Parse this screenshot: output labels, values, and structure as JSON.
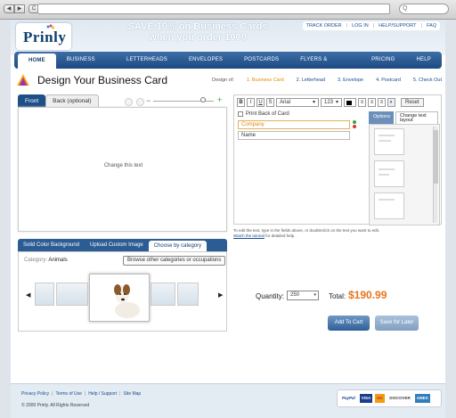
{
  "browser": {
    "back_label": "◀",
    "forward_label": "▶",
    "reload_label": "C",
    "search_label": "Q"
  },
  "header": {
    "logo": "Prinly",
    "promo_line1": "SAVE 10% on Business Cards",
    "promo_line2": "when you order 1000",
    "links": [
      "TRACK ORDER",
      "LOG IN",
      "HELP/SUPPORT",
      "FAQ"
    ]
  },
  "nav": {
    "items": [
      "HOME",
      "BUSINESS CARDS",
      "LETTERHEADS",
      "ENVELOPES",
      "POSTCARDS",
      "FLYERS & BROCHURES",
      "PRICING",
      "HELP"
    ],
    "active_index": 0
  },
  "design": {
    "title": "Design Your Business Card",
    "steps_label": "Design of:",
    "steps": [
      "1. Business Card",
      "2. Letterhead",
      "3. Envelope",
      "4. Postcard",
      "5. Check Out"
    ],
    "current_step": 0
  },
  "preview": {
    "tabs": [
      "Front",
      "Back (optional)"
    ],
    "selected_tab": 0,
    "placeholder": "Change this text"
  },
  "editor": {
    "bold": "B",
    "italic": "I",
    "underline": "U",
    "strike": "S",
    "font": "Arial",
    "size": "123",
    "reset": "Reset",
    "print_back": "Print Back of Card",
    "fields": [
      "Company",
      "Name"
    ],
    "right_tabs": [
      "Options",
      "Change text layout"
    ],
    "hint": "To edit the text, type in the fields above, or doubleclick on the text you want to edit.",
    "hint_link": "Watch the tutorial",
    "hint_tail": "for detailed help."
  },
  "backgrounds": {
    "tabs": [
      "Solid Color Background",
      "Upload Custom Image",
      "Choose by category"
    ],
    "selected_tab": 2,
    "category_label": "Category:",
    "category_value": "Animals",
    "browse_button": "Browse other categories or occupations",
    "prev": "◀",
    "next": "▶"
  },
  "order": {
    "quantity_label": "Quantity:",
    "quantity_value": "250",
    "total_label": "Total:",
    "total_value": "$190.99",
    "add_to_cart": "Add To Cart",
    "save_later": "Save for Later"
  },
  "footer": {
    "links": [
      "Privacy Policy",
      "Terms of Use",
      "Help / Support",
      "Site Map"
    ],
    "copyright": "© 2009 Prinly. All Rights Reserved",
    "payments": [
      "PayPal",
      "VISA",
      "MC",
      "DISCOVER",
      "AMEX"
    ]
  },
  "colors": {
    "nav": "#1d4a82",
    "accent_orange": "#e8741a",
    "link": "#1a4d8f"
  }
}
